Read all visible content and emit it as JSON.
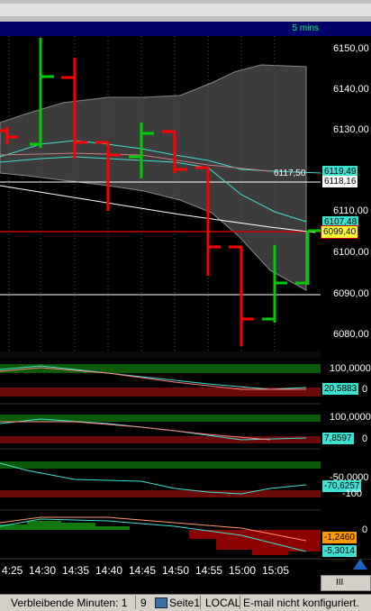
{
  "chart": {
    "timeframe": "5 mins",
    "price_axis": [
      "6150,00",
      "6140,00",
      "6130,00",
      "6120,00",
      "6110,00",
      "6100,00",
      "6090,00",
      "6080,00"
    ],
    "price_tags": {
      "band_top": "6119,49",
      "band_mid": "6118,16",
      "line_label": "6117,50",
      "band_low": "6107,48",
      "last_price": "6099,40"
    },
    "panel1": {
      "top": "100,0000",
      "value": "20,5883",
      "bottom": "0"
    },
    "panel2": {
      "top": "100,0000",
      "value": "7,8597",
      "bottom": "0"
    },
    "panel3": {
      "level": "-50,0000",
      "value": "-70,6257",
      "bottom": "-100"
    },
    "panel4": {
      "top": "0",
      "value1": "-1,2460",
      "value2": "-5,3014"
    },
    "time_axis": [
      "4:25",
      "14:30",
      "14:35",
      "14:40",
      "14:45",
      "14:50",
      "14:55",
      "15:00",
      "15:05"
    ],
    "colors": {
      "up": "#00cc00",
      "down": "#ff0000",
      "background": "#000000",
      "title_bar": "#00006a"
    }
  },
  "status": {
    "remaining": "Verbleibende Minuten: 1",
    "num": "9",
    "page": "Seite1",
    "mode": "LOCAL",
    "email": "E-mail nicht konfiguriert."
  }
}
